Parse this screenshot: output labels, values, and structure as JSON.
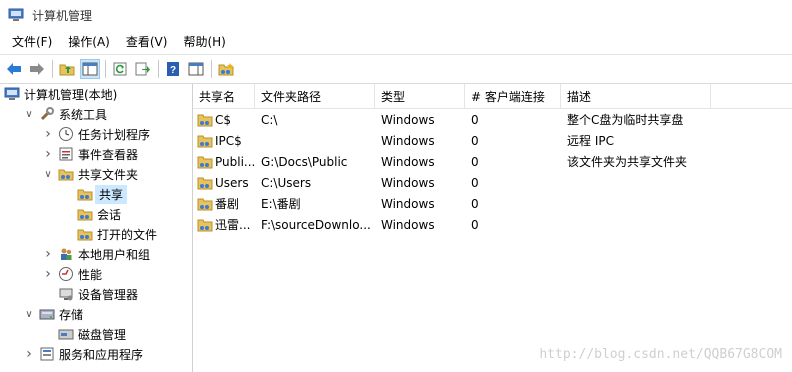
{
  "window": {
    "title": "计算机管理"
  },
  "menu": [
    "文件(F)",
    "操作(A)",
    "查看(V)",
    "帮助(H)"
  ],
  "toolbar": {
    "buttons": [
      "back-arrow-icon",
      "forward-arrow-icon",
      "up-folder-icon",
      "show-hide-tree-icon",
      "refresh-icon",
      "export-list-icon",
      "help-icon",
      "show-action-pane-icon",
      "new-share-icon"
    ]
  },
  "tree": {
    "items": [
      {
        "label": "计算机管理(本地)",
        "level": 0,
        "expander": "",
        "icon": "computer-management-icon"
      },
      {
        "label": "系统工具",
        "level": 1,
        "expander": "open",
        "icon": "system-tools-icon"
      },
      {
        "label": "任务计划程序",
        "level": 2,
        "expander": "closed",
        "icon": "clock-icon"
      },
      {
        "label": "事件查看器",
        "level": 2,
        "expander": "closed",
        "icon": "event-viewer-icon"
      },
      {
        "label": "共享文件夹",
        "level": 2,
        "expander": "open",
        "icon": "shared-folder-icon"
      },
      {
        "label": "共享",
        "level": 3,
        "expander": "",
        "icon": "shared-folder-icon",
        "selected": true
      },
      {
        "label": "会话",
        "level": 3,
        "expander": "",
        "icon": "shared-folder-icon"
      },
      {
        "label": "打开的文件",
        "level": 3,
        "expander": "",
        "icon": "shared-folder-icon"
      },
      {
        "label": "本地用户和组",
        "level": 2,
        "expander": "closed",
        "icon": "users-icon"
      },
      {
        "label": "性能",
        "level": 2,
        "expander": "closed",
        "icon": "performance-icon"
      },
      {
        "label": "设备管理器",
        "level": 2,
        "expander": "",
        "icon": "device-manager-icon"
      },
      {
        "label": "存储",
        "level": 1,
        "expander": "open",
        "icon": "storage-icon"
      },
      {
        "label": "磁盘管理",
        "level": 2,
        "expander": "",
        "icon": "disk-management-icon"
      },
      {
        "label": "服务和应用程序",
        "level": 1,
        "expander": "closed",
        "icon": "services-icon"
      }
    ]
  },
  "list": {
    "columns": [
      "共享名",
      "文件夹路径",
      "类型",
      "# 客户端连接",
      "描述"
    ],
    "rows": [
      {
        "name": "C$",
        "path": "C:\\",
        "type": "Windows",
        "clients": "0",
        "desc": "整个C盘为临时共享盘"
      },
      {
        "name": "IPC$",
        "path": "",
        "type": "Windows",
        "clients": "0",
        "desc": "远程 IPC"
      },
      {
        "name": "Publi...",
        "path": "G:\\Docs\\Public",
        "type": "Windows",
        "clients": "0",
        "desc": "该文件夹为共享文件夹"
      },
      {
        "name": "Users",
        "path": "C:\\Users",
        "type": "Windows",
        "clients": "0",
        "desc": ""
      },
      {
        "name": "番剧",
        "path": "E:\\番剧",
        "type": "Windows",
        "clients": "0",
        "desc": ""
      },
      {
        "name": "迅雷...",
        "path": "F:\\sourceDownlo...",
        "type": "Windows",
        "clients": "0",
        "desc": ""
      }
    ]
  },
  "watermark": "http://blog.csdn.net/QQB67G8COM"
}
